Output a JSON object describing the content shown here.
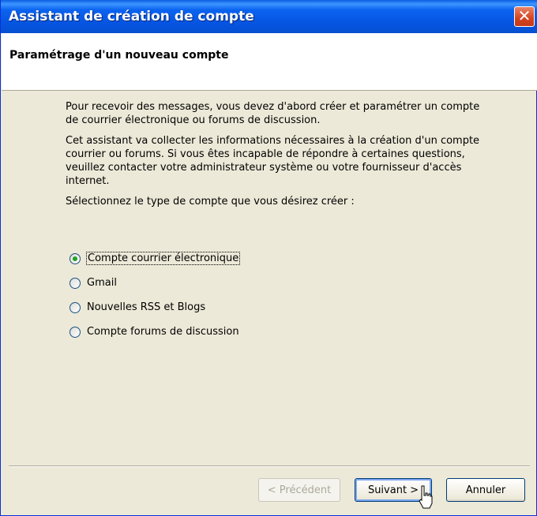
{
  "window": {
    "title": "Assistant de création de compte",
    "close_glyph": "✕"
  },
  "header": {
    "title": "Paramétrage d'un nouveau compte"
  },
  "content": {
    "paragraphs": [
      "Pour recevoir des messages, vous devez d'abord créer et paramétrer un compte de courrier électronique ou forums de discussion.",
      "Cet assistant va collecter les informations nécessaires à la création d'un compte courrier ou forums. Si vous êtes incapable de répondre à certaines questions, veuillez contacter votre administrateur système ou votre fournisseur d'accès internet.",
      "Sélectionnez le type de compte que vous désirez créer :"
    ]
  },
  "account_types": {
    "selected": "Compte courrier électronique",
    "options": [
      "Compte courrier électronique",
      "Gmail",
      "Nouvelles RSS et Blogs",
      "Compte forums de discussion"
    ]
  },
  "buttons": {
    "previous": "< Précédent",
    "next": "Suivant >",
    "cancel": "Annuler"
  }
}
